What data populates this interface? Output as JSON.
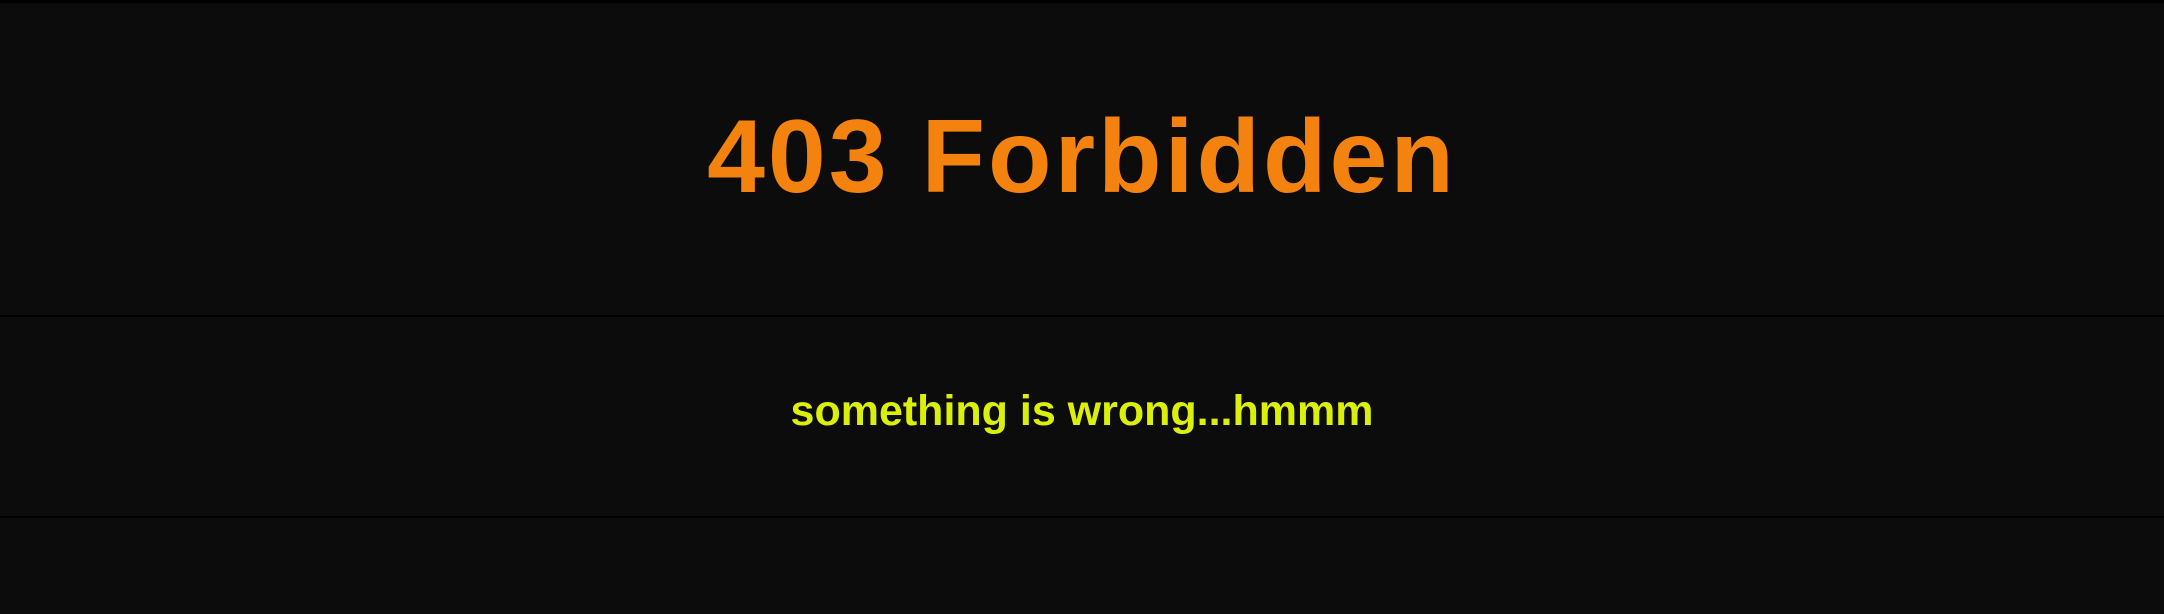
{
  "error": {
    "title": "403 Forbidden",
    "message": "something is wrong...hmmm"
  },
  "colors": {
    "background": "#0c0c0c",
    "divider": "#000000",
    "title": "#f4820e",
    "message": "#daf00a"
  }
}
